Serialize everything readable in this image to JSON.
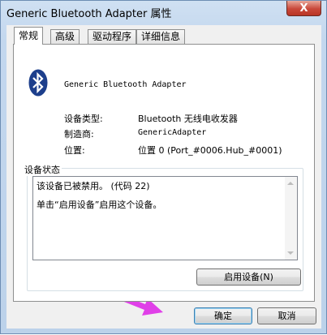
{
  "window": {
    "title": "Generic Bluetooth Adapter 属性",
    "close_symbol": "X"
  },
  "tabs": [
    {
      "label": "常规",
      "active": true
    },
    {
      "label": "高级",
      "active": false
    },
    {
      "label": "驱动程序",
      "active": false
    },
    {
      "label": "详细信息",
      "active": false
    }
  ],
  "device": {
    "icon": "bluetooth-icon",
    "name": "Generic Bluetooth Adapter"
  },
  "properties": [
    {
      "label": "设备类型:",
      "value": "Bluetooth 无线电收发器"
    },
    {
      "label": "制造商:",
      "value": "GenericAdapter"
    },
    {
      "label": "位置:",
      "value": "位置 0 (Port_#0006.Hub_#0001)"
    }
  ],
  "status": {
    "group_title": "设备状态",
    "lines": [
      "该设备已被禁用。 (代码 22)",
      "单击“启用设备”启用这个设备。"
    ]
  },
  "buttons": {
    "enable": "启用设备(N)",
    "ok": "确定",
    "cancel": "取消"
  },
  "colors": {
    "arrow": "#e040e8",
    "bluetooth_icon_bg": "#1d3f8c"
  }
}
